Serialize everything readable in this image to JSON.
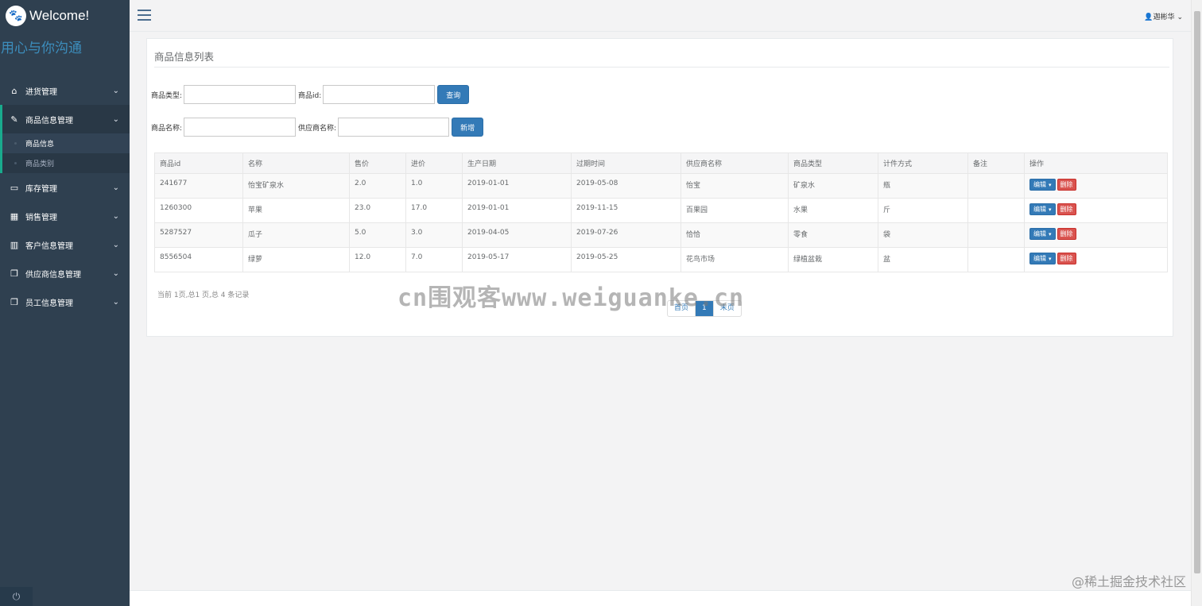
{
  "sidebar": {
    "brand": "Welcome!",
    "slogan": "用心与你沟通",
    "items": [
      {
        "label": "进货管理",
        "icon": "home-icon"
      },
      {
        "label": "商品信息管理",
        "icon": "edit-icon"
      },
      {
        "label": "库存管理",
        "icon": "desktop-icon"
      },
      {
        "label": "销售管理",
        "icon": "table-icon"
      },
      {
        "label": "客户信息管理",
        "icon": "bar-chart-icon"
      },
      {
        "label": "供应商信息管理",
        "icon": "copy-icon"
      },
      {
        "label": "员工信息管理",
        "icon": "copy-icon"
      }
    ],
    "subitems": [
      "商品信息",
      "商品类别"
    ]
  },
  "topbar": {
    "user": "迦彬华"
  },
  "panel": {
    "title": "商品信息列表"
  },
  "search": {
    "type_label": "商品类型:",
    "id_label": "商品id:",
    "query_button": "查询",
    "name_label": "商品名称:",
    "supplier_label": "供应商名称:",
    "add_button": "新增"
  },
  "table": {
    "headers": [
      "商品id",
      "名称",
      "售价",
      "进价",
      "生产日期",
      "过期时间",
      "供应商名称",
      "商品类型",
      "计件方式",
      "备注",
      "操作"
    ],
    "rows": [
      [
        "241677",
        "怡宝矿泉水",
        "2.0",
        "1.0",
        "2019-01-01",
        "2019-05-08",
        "怡宝",
        "矿泉水",
        "瓶",
        ""
      ],
      [
        "1260300",
        "苹果",
        "23.0",
        "17.0",
        "2019-01-01",
        "2019-11-15",
        "百果园",
        "水果",
        "斤",
        ""
      ],
      [
        "5287527",
        "瓜子",
        "5.0",
        "3.0",
        "2019-04-05",
        "2019-07-26",
        "恰恰",
        "零食",
        "袋",
        ""
      ],
      [
        "8556504",
        "绿萝",
        "12.0",
        "7.0",
        "2019-05-17",
        "2019-05-25",
        "花鸟市场",
        "绿植盆栽",
        "盆",
        ""
      ]
    ],
    "edit_label": "编辑",
    "delete_label": "删除"
  },
  "pagination": {
    "info": "当前 1页,总1 页,总 4 条记录",
    "first": "首页",
    "current": "1",
    "last": "末页"
  },
  "watermarks": [
    "cn围观客www.weiguanke.cn",
    "@稀土掘金技术社区"
  ]
}
